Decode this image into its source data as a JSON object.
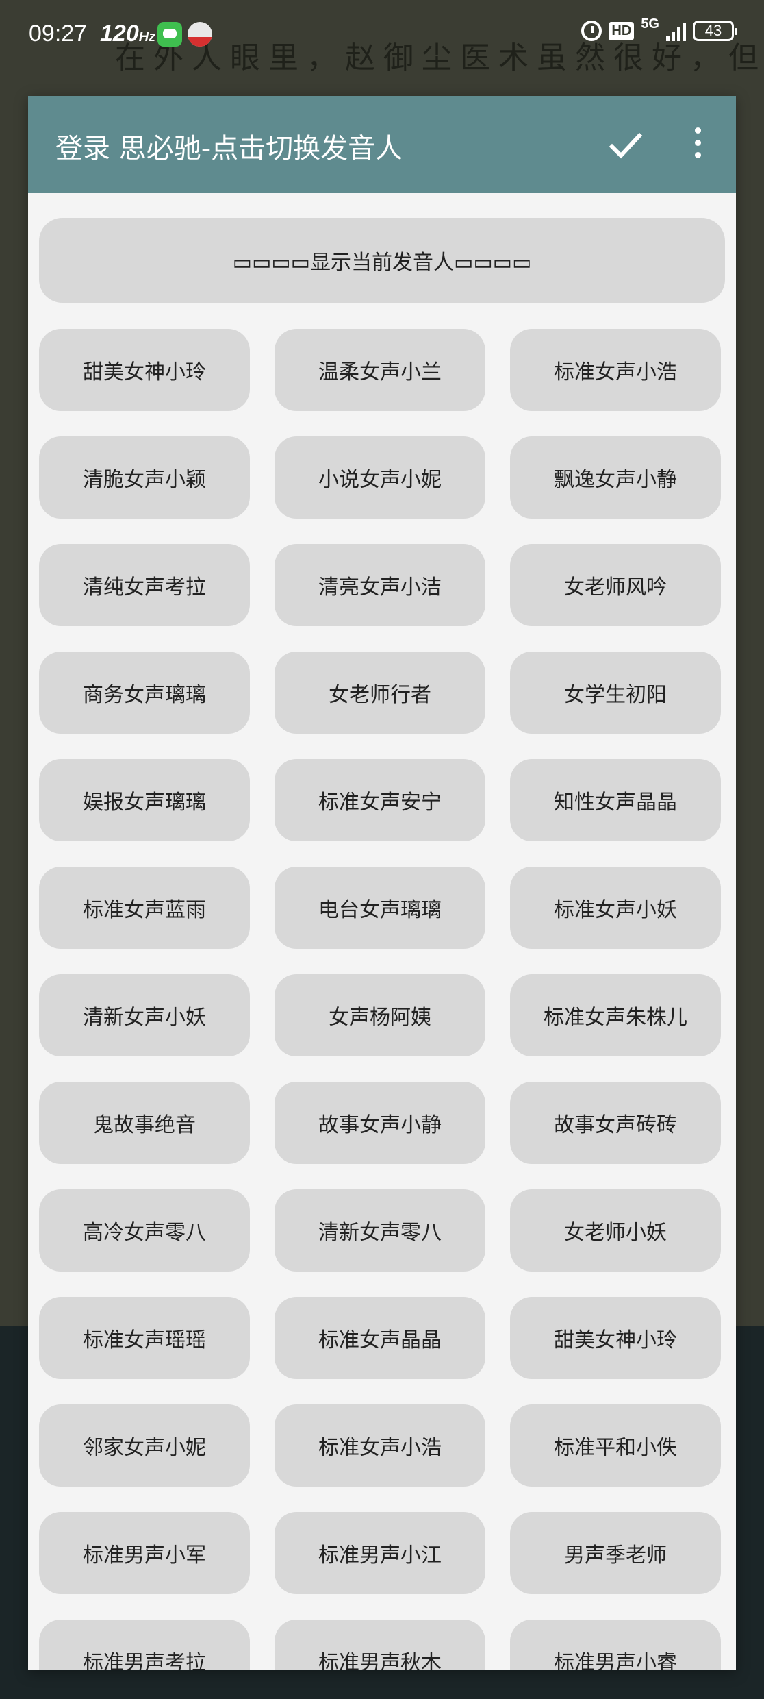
{
  "status_bar": {
    "time": "09:27",
    "refresh_rate": "120",
    "refresh_unit": "Hz",
    "hd_label": "HD",
    "network_label": "5G",
    "battery_level": "43"
  },
  "background_text": {
    "line1": "在外人眼里，赵御尘医术虽然很好，但",
    "line2": ""
  },
  "dialog": {
    "title": "登录 思必驰-点击切换发音人",
    "confirm_icon": "check-icon",
    "more_icon": "more-vert-icon",
    "current_voice_label": "▭▭▭▭显示当前发音人▭▭▭▭",
    "voices": [
      "甜美女神小玲",
      "温柔女声小兰",
      "标准女声小浩",
      "清脆女声小颖",
      "小说女声小妮",
      "飘逸女声小静",
      "清纯女声考拉",
      "清亮女声小洁",
      "女老师风吟",
      "商务女声璃璃",
      "女老师行者",
      "女学生初阳",
      "娱报女声璃璃",
      "标准女声安宁",
      "知性女声晶晶",
      "标准女声蓝雨",
      "电台女声璃璃",
      "标准女声小妖",
      "清新女声小妖",
      "女声杨阿姨",
      "标准女声朱株儿",
      "鬼故事绝音",
      "故事女声小静",
      "故事女声砖砖",
      "高冷女声零八",
      "清新女声零八",
      "女老师小妖",
      "标准女声瑶瑶",
      "标准女声晶晶",
      "甜美女神小玲",
      "邻家女声小妮",
      "标准女声小浩",
      "标准平和小佚",
      "标准男声小军",
      "标准男声小江",
      "男声季老师",
      "标准男声考拉",
      "标准男声秋木",
      "标准男声小睿"
    ]
  },
  "colors": {
    "toolbar": "#5f8b8f",
    "dialog_background": "#f4f4f4",
    "button_background": "#d8d8d8"
  }
}
